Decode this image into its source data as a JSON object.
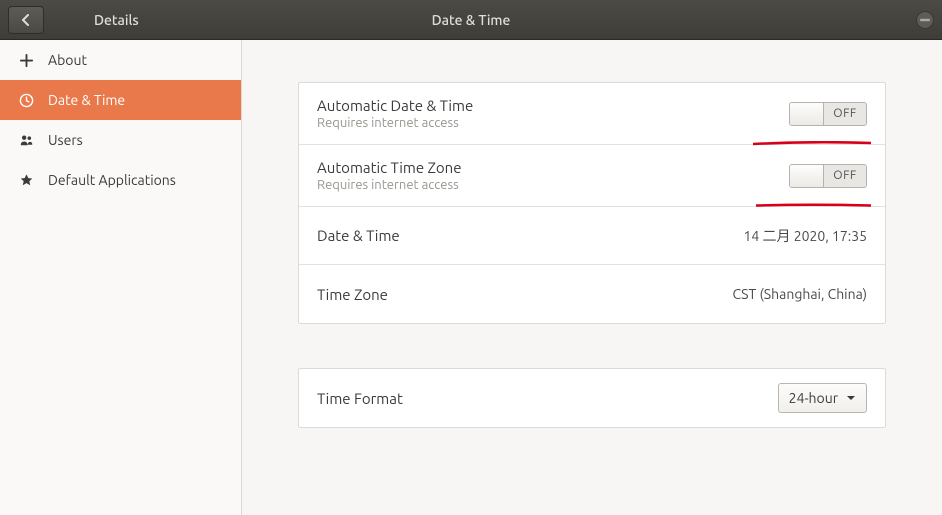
{
  "titlebar": {
    "left_label": "Details",
    "center_label": "Date & Time"
  },
  "sidebar": {
    "items": [
      {
        "label": "About"
      },
      {
        "label": "Date & Time"
      },
      {
        "label": "Users"
      },
      {
        "label": "Default Applications"
      }
    ]
  },
  "rows": {
    "auto_datetime": {
      "title": "Automatic Date & Time",
      "sub": "Requires internet access",
      "toggle": "OFF"
    },
    "auto_tz": {
      "title": "Automatic Time Zone",
      "sub": "Requires internet access",
      "toggle": "OFF"
    },
    "datetime": {
      "title": "Date & Time",
      "value": "14 二月 2020, 17:35"
    },
    "tz": {
      "title": "Time Zone",
      "value": "CST (Shanghai, China)"
    },
    "format": {
      "title": "Time Format",
      "value": "24-hour"
    }
  }
}
